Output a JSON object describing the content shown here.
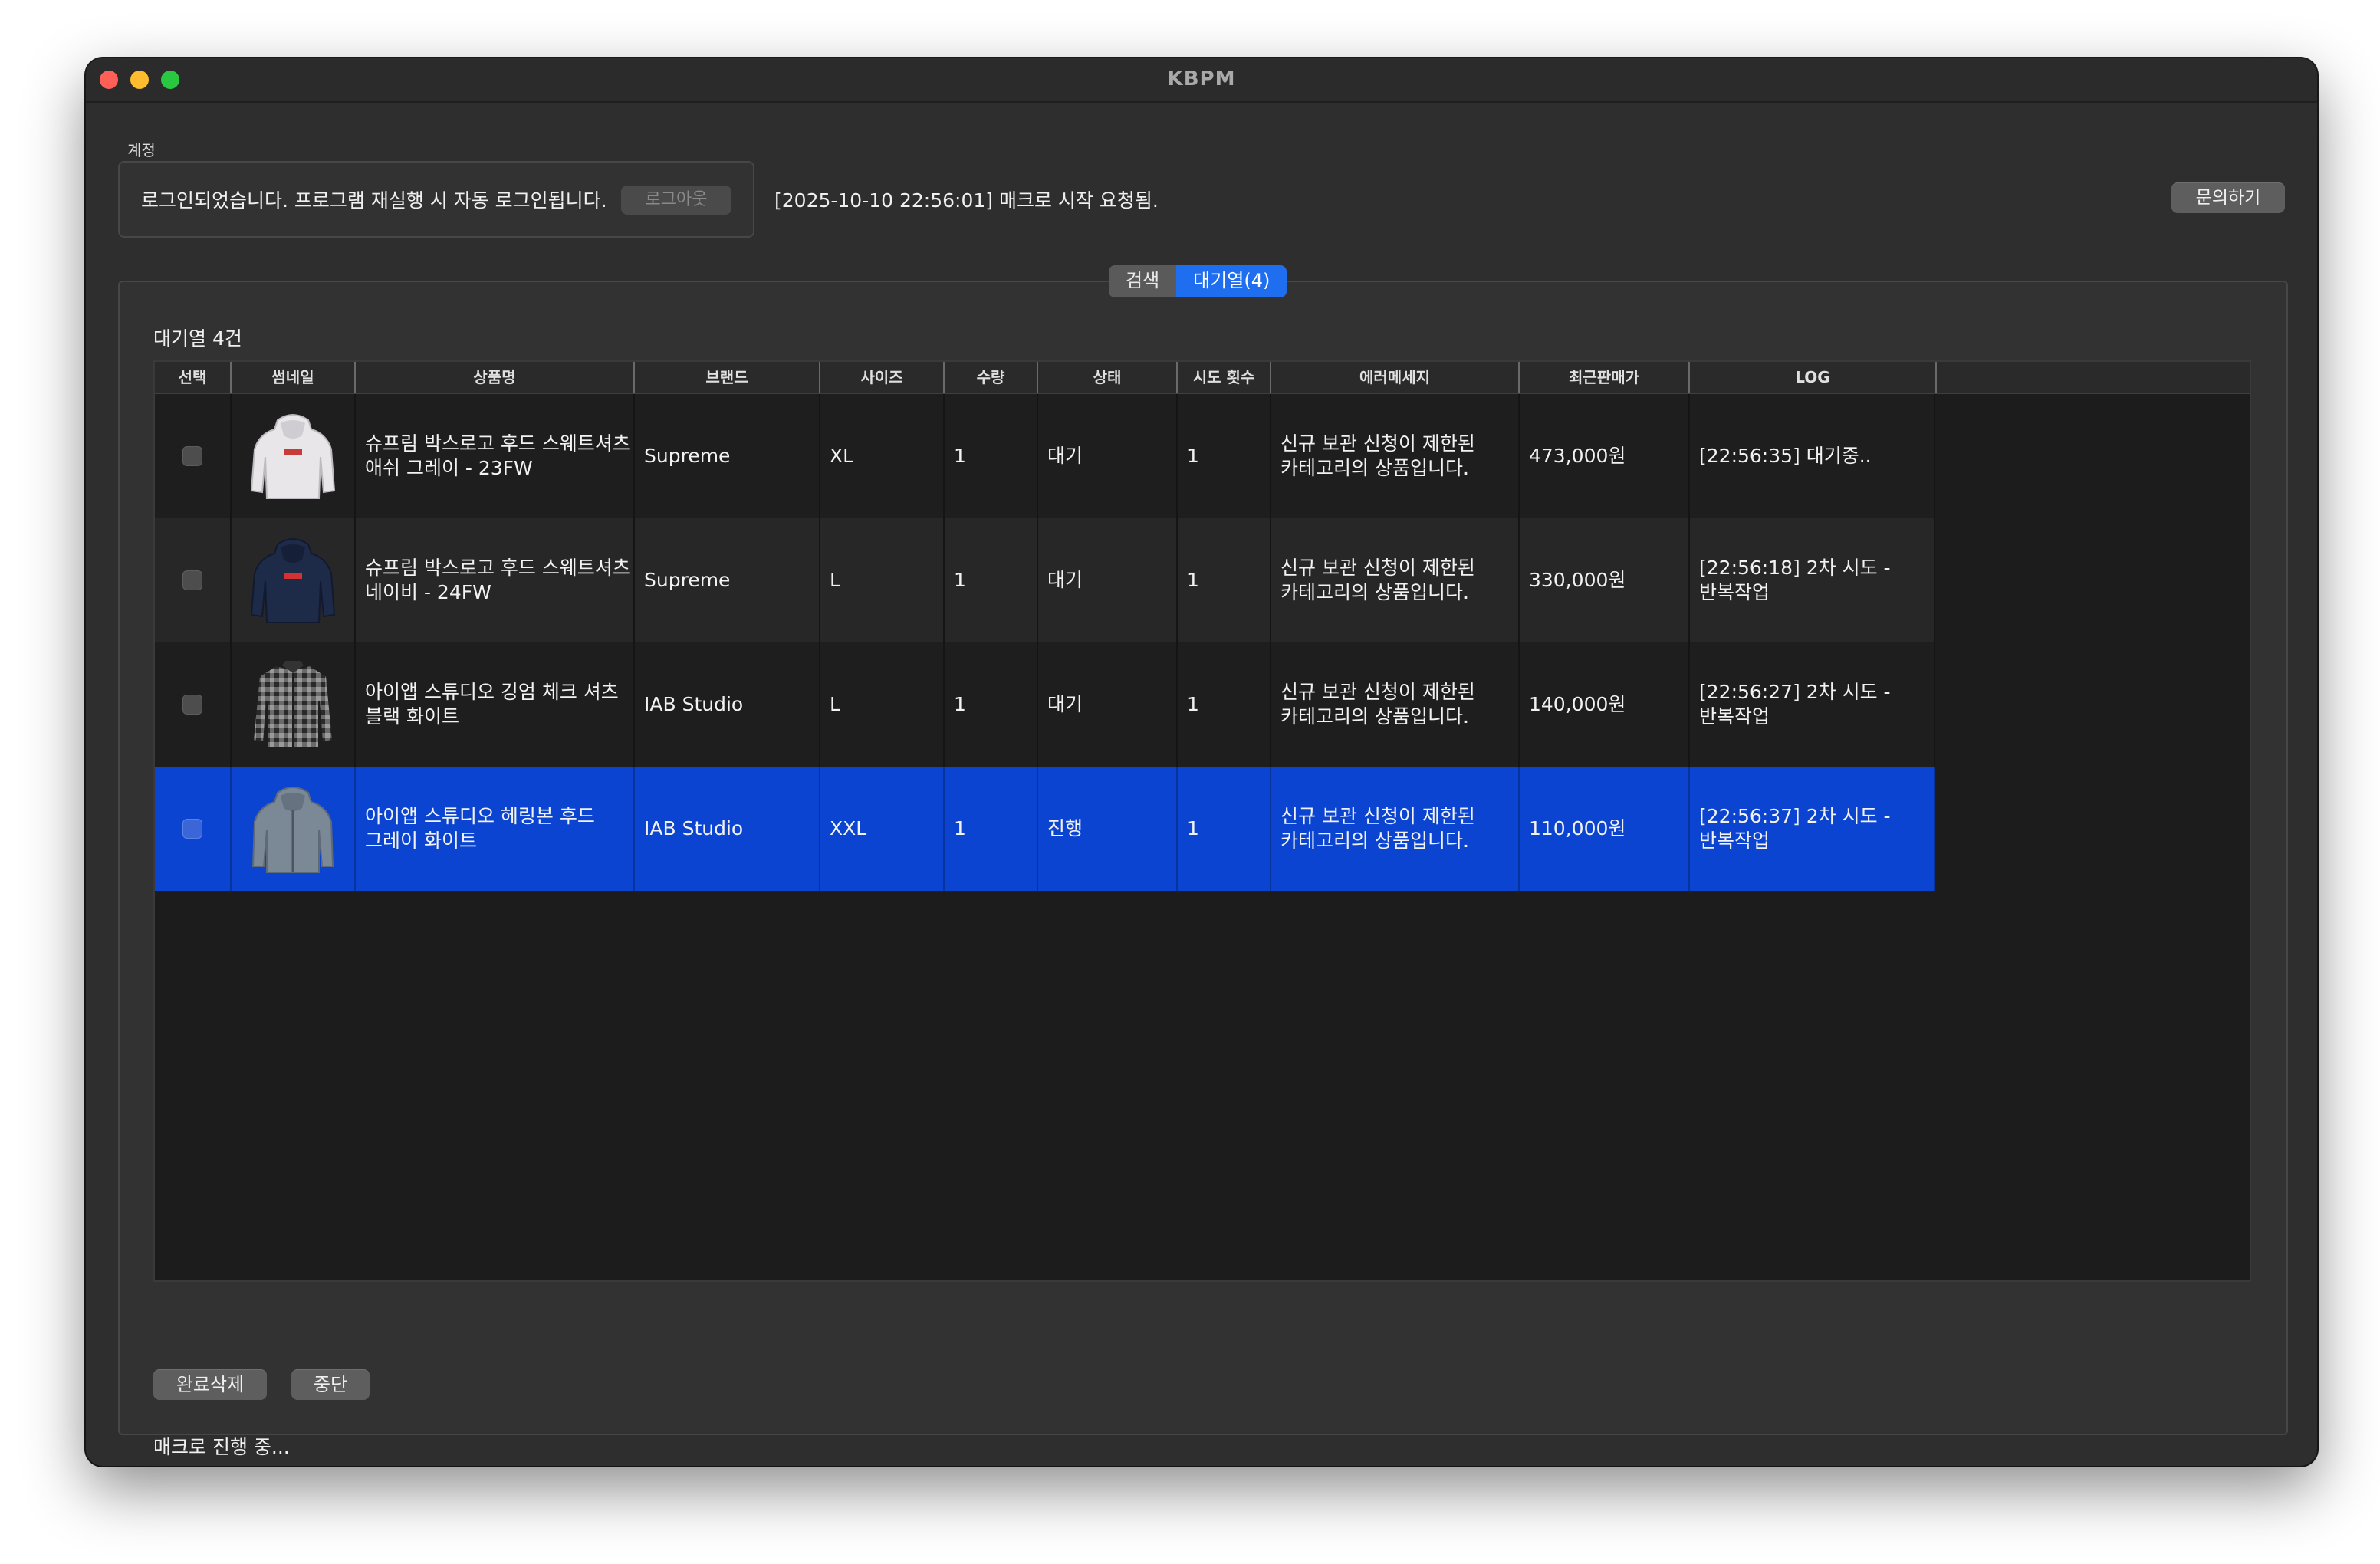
{
  "window": {
    "title": "KBPM"
  },
  "account": {
    "section_label": "계정",
    "login_message": "로그인되었습니다. 프로그램 재실행 시 자동 로그인됩니다.",
    "logout_label": "로그아웃"
  },
  "log_message": "[2025-10-10 22:56:01] 매크로 시작 요청됨.",
  "contact_label": "문의하기",
  "tabs": [
    {
      "label": "검색",
      "active": false
    },
    {
      "label": "대기열(4)",
      "active": true
    }
  ],
  "queue": {
    "title": "대기열 4건",
    "columns": [
      "선택",
      "썸네일",
      "상품명",
      "브랜드",
      "사이즈",
      "수량",
      "상태",
      "시도 횟수",
      "에러메세지",
      "최근판매가",
      "LOG"
    ],
    "rows": [
      {
        "name_line1": "슈프림 박스로고 후드 스웨트셔츠",
        "name_line2": "애쉬 그레이 - 23FW",
        "brand": "Supreme",
        "size": "XL",
        "qty": "1",
        "status": "대기",
        "attempts": "1",
        "error_line1": "신규 보관 신청이 제한된",
        "error_line2": "카테고리의 상품입니다.",
        "price": "473,000원",
        "log_line1": "[22:56:35] 대기중..",
        "log_line2": "",
        "thumb": "hoodie-ash-gray",
        "selected": false
      },
      {
        "name_line1": "슈프림 박스로고 후드 스웨트셔츠",
        "name_line2": "네이비 - 24FW",
        "brand": "Supreme",
        "size": "L",
        "qty": "1",
        "status": "대기",
        "attempts": "1",
        "error_line1": "신규 보관 신청이 제한된",
        "error_line2": "카테고리의 상품입니다.",
        "price": "330,000원",
        "log_line1": "[22:56:18] 2차 시도 -",
        "log_line2": "반복작업",
        "thumb": "hoodie-navy",
        "selected": false
      },
      {
        "name_line1": "아이앱 스튜디오 깅엄 체크 셔츠",
        "name_line2": "블랙 화이트",
        "brand": "IAB Studio",
        "size": "L",
        "qty": "1",
        "status": "대기",
        "attempts": "1",
        "error_line1": "신규 보관 신청이 제한된",
        "error_line2": "카테고리의 상품입니다.",
        "price": "140,000원",
        "log_line1": "[22:56:27] 2차 시도 -",
        "log_line2": "반복작업",
        "thumb": "check-shirt-black",
        "selected": false
      },
      {
        "name_line1": "아이앱 스튜디오 헤링본 후드",
        "name_line2": "그레이 화이트",
        "brand": "IAB Studio",
        "size": "XXL",
        "qty": "1",
        "status": "진행",
        "attempts": "1",
        "error_line1": "신규 보관 신청이 제한된",
        "error_line2": "카테고리의 상품입니다.",
        "price": "110,000원",
        "log_line1": "[22:56:37] 2차 시도 -",
        "log_line2": "반복작업",
        "thumb": "zip-hoodie-gray",
        "selected": true
      }
    ]
  },
  "buttons": {
    "clear_done": "완료삭제",
    "stop": "중단"
  },
  "status_text": "매크로 진행 중...",
  "colors": {
    "accent": "#1f6ef0",
    "selected_row": "#0a44d0",
    "background": "#2e2e2e"
  }
}
